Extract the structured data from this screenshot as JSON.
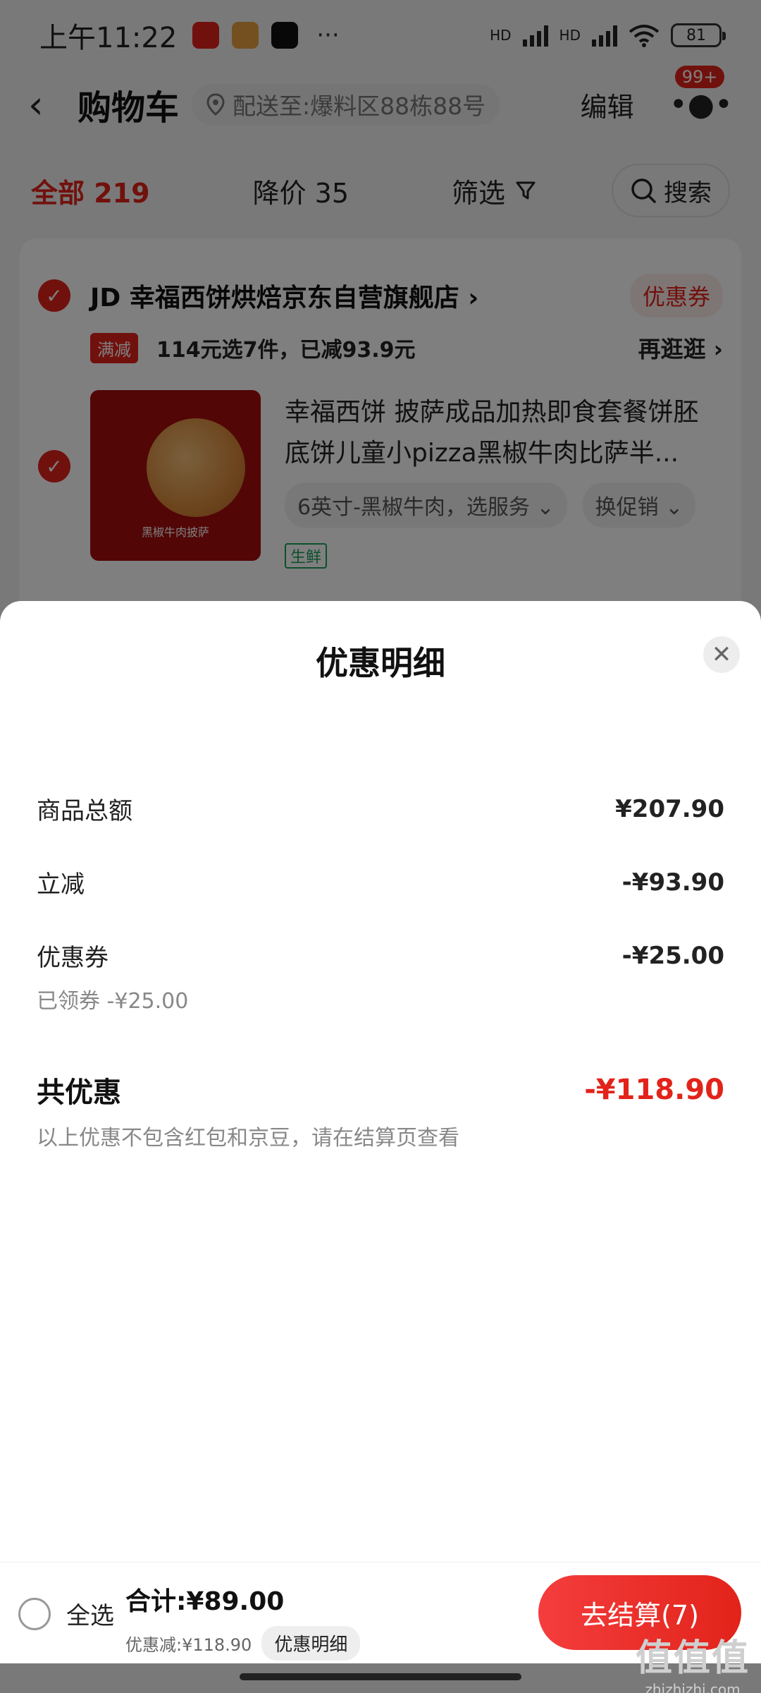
{
  "status_bar": {
    "time": "上午11:22",
    "more": "···",
    "hd_labels": [
      "HD",
      "HD"
    ],
    "battery": "81"
  },
  "nav": {
    "back_icon": "chevron-left-icon",
    "title": "购物车",
    "address": "配送至:爆料区88栋88号",
    "edit": "编辑",
    "more_badge": "99+"
  },
  "tabs": {
    "all": "全部 219",
    "price_drop": "降价 35",
    "filter": "筛选",
    "search": "搜索"
  },
  "shop": {
    "name": "JD 幸福西饼烘焙京东自营旗舰店 ›",
    "coupon": "优惠券",
    "promo_tag": "满减",
    "promo_text": "114元选7件，已减93.9元",
    "promo_link": "再逛逛 ›",
    "item": {
      "title": "幸福西饼 披萨成品加热即食套餐饼胚底饼儿童小pizza黑椒牛肉比萨半...",
      "image_caption": "黑椒牛肉披萨",
      "sku": "6英寸-黑椒牛肉，选服务 ⌄",
      "promo_select": "换促销 ⌄",
      "fresh_tag": "生鲜"
    }
  },
  "sheet": {
    "title": "优惠明细",
    "rows": [
      {
        "label": "商品总额",
        "value": "¥207.90"
      },
      {
        "label": "立减",
        "value": "-¥93.90"
      },
      {
        "label": "优惠券",
        "value": "-¥25.00",
        "sub": "已领券 -¥25.00"
      }
    ],
    "total_label": "共优惠",
    "total_value": "-¥118.90",
    "note": "以上优惠不包含红包和京豆，请在结算页查看"
  },
  "bottom_bar": {
    "select_all": "全选",
    "sum": "合计:¥89.00",
    "saved": "优惠减:¥118.90",
    "detail": "优惠明细",
    "checkout": "去结算(7)"
  },
  "watermark": {
    "main": "值值值",
    "sub": "zhizhizhi.com"
  },
  "colors": {
    "accent": "#e2231a",
    "fresh": "#1aa15a"
  }
}
